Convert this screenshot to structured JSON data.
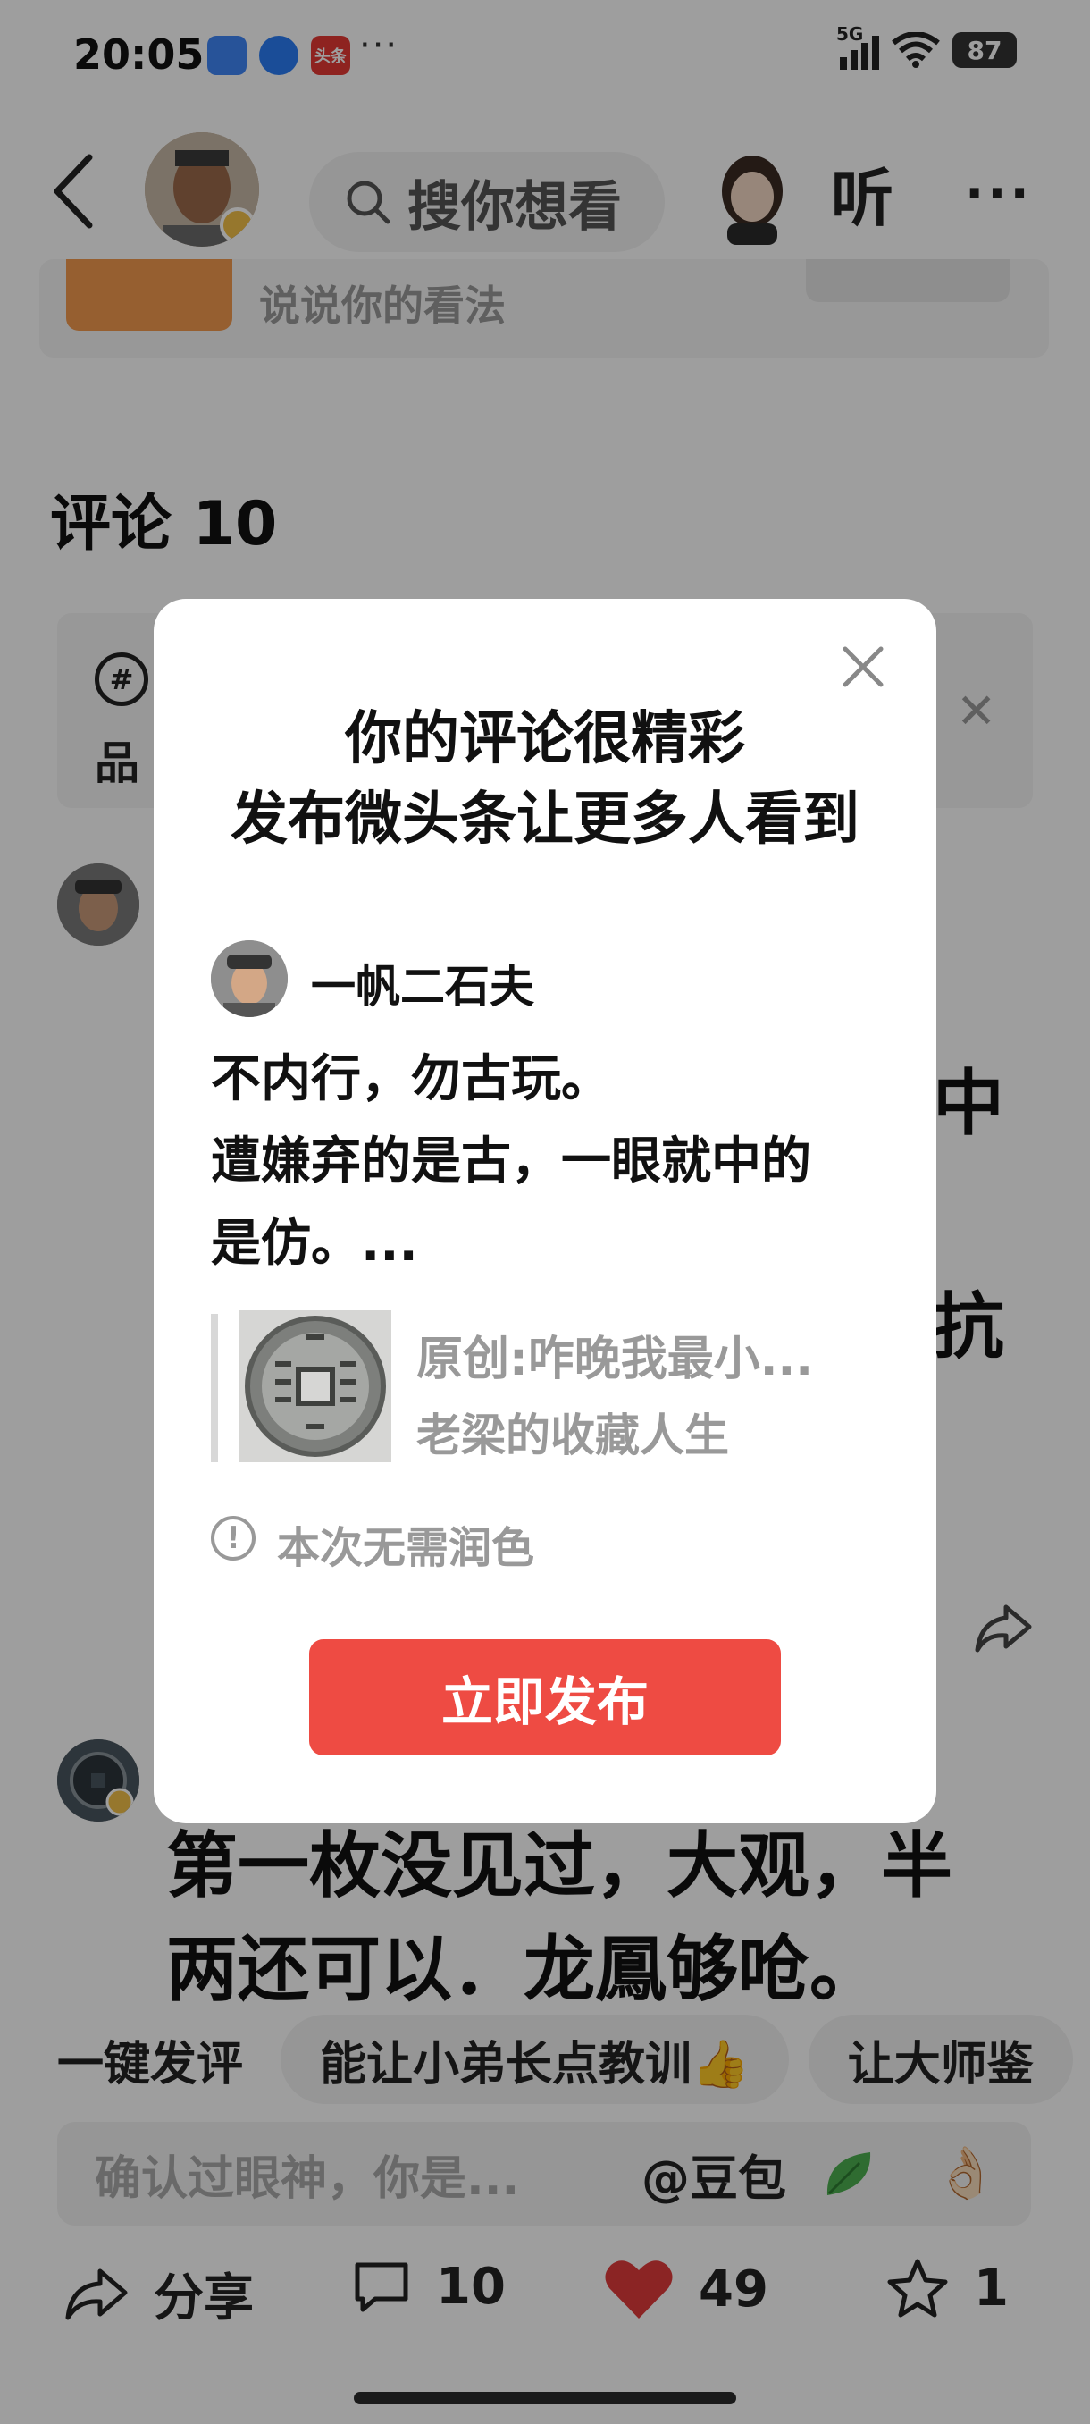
{
  "status_bar": {
    "time": "20:05",
    "dots": "···",
    "signal": "5G",
    "battery": "87",
    "app_badge": "头条"
  },
  "header": {
    "search_placeholder": "搜你想看",
    "listen_label": "听",
    "more_label": "···"
  },
  "share_prompt": {
    "text": "说说你的看法"
  },
  "comments": {
    "title": "评论 10",
    "topic_icon": "#",
    "topic_text": "品",
    "fragment_1": "中",
    "fragment_2": "抗",
    "comment_2_line_1": "第一枚没见过，大观，半",
    "comment_2_line_2": "两还可以．龙鳳够呛。"
  },
  "quick_reply": {
    "label": "一键发评",
    "chips": [
      "能让小弟长点教训👍",
      "让大师鉴"
    ]
  },
  "composer": {
    "placeholder": "确认过眼神，你是...",
    "mention": "@豆包",
    "emoji_ok": "👌🏻"
  },
  "toolbar": {
    "share_label": "分享",
    "comment_count": "10",
    "like_count": "49",
    "favorite_count": "1",
    "like_color": "#e03a3a"
  },
  "modal": {
    "title_line_1": "你的评论很精彩",
    "title_line_2": "发布微头条让更多人看到",
    "username": "一帆二石夫",
    "body_line_1": "不内行，勿古玩。",
    "body_line_2": "遭嫌弃的是古，一眼就中的",
    "body_line_3": "是仿。...",
    "quote_title": "原创:咋晚我最小...",
    "quote_author": "老梁的收藏人生",
    "hint_icon": "!",
    "hint": "本次无需润色",
    "publish_label": "立即发布",
    "accent_color": "#ee4b43"
  }
}
